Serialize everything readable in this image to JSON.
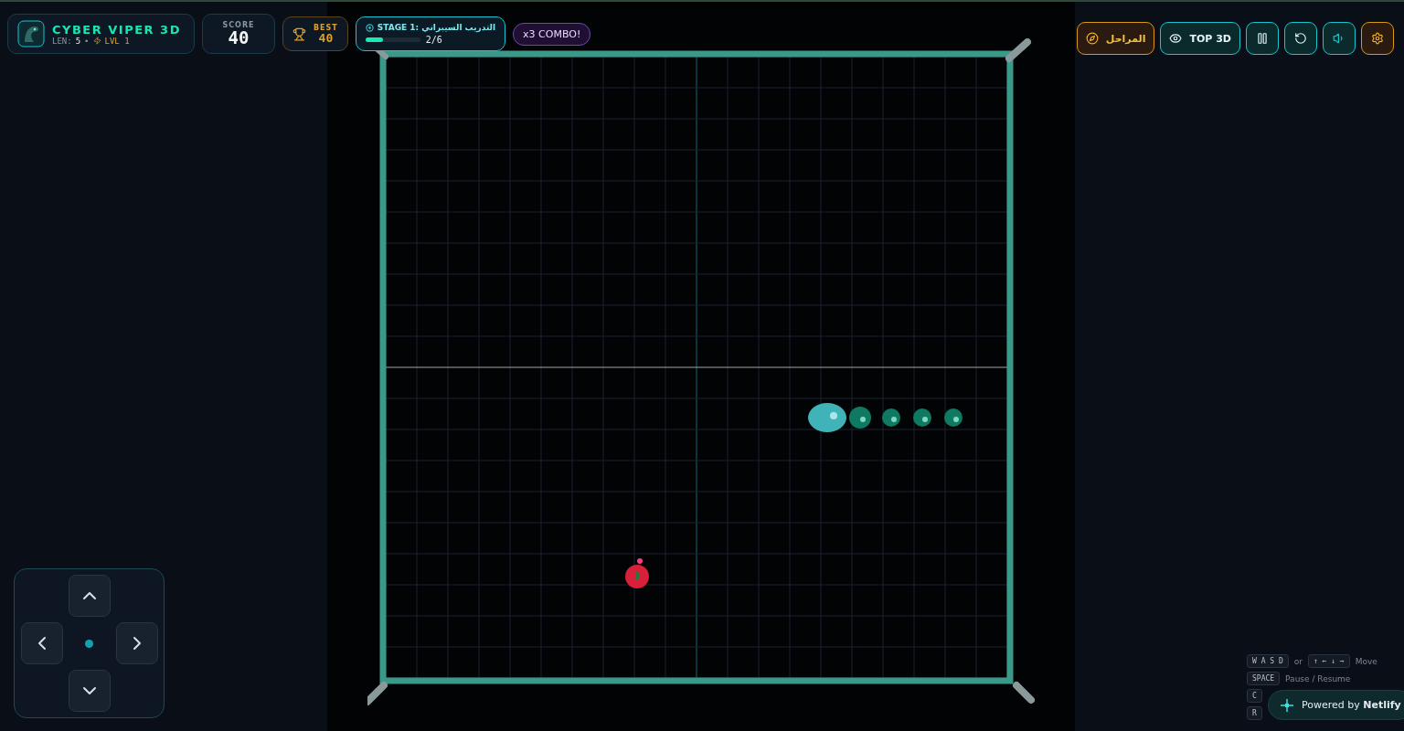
{
  "player": {
    "title": "CYBER VIPER 3D",
    "length_label": "LEN:",
    "length": "5",
    "separator": "•",
    "level": "LVL 1"
  },
  "score": {
    "label": "SCORE",
    "value": "40"
  },
  "best": {
    "label": "BEST",
    "value": "40"
  },
  "stage": {
    "title": "STAGE 1: التدريب السيبراني",
    "progress": "2/6",
    "level": 0.32
  },
  "combo": "x3 COMBO!",
  "toolbar": [
    {
      "kind": "stages",
      "label": "المراحل"
    },
    {
      "kind": "leaderboard",
      "label": "TOP 3D"
    },
    {
      "kind": "pause"
    },
    {
      "kind": "restart"
    },
    {
      "kind": "sound"
    },
    {
      "kind": "settings"
    }
  ],
  "dpad": [
    {
      "kind": "up"
    },
    {
      "kind": "left"
    },
    {
      "kind": "right"
    },
    {
      "kind": "down"
    }
  ],
  "help": [
    {
      "keys": [
        "W A S D"
      ],
      "joiner": "or",
      "alt_keys": [
        "↑ ← ↓ →"
      ],
      "action": "Move"
    },
    {
      "keys": [
        "SPACE"
      ],
      "action": "Pause / Resume"
    },
    {
      "keys": [
        "C"
      ]
    },
    {
      "keys": [
        "R"
      ]
    }
  ],
  "badge": "Powered by **Netlify**"
}
